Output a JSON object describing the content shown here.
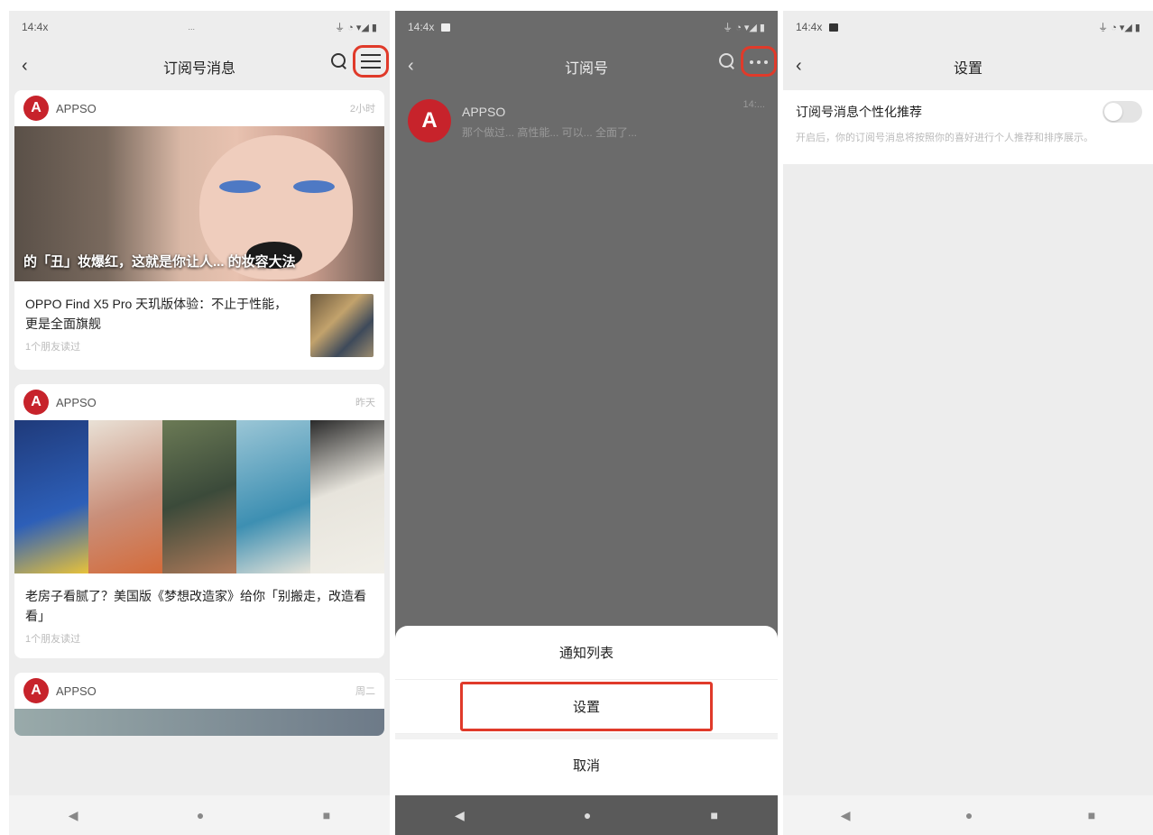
{
  "panel1": {
    "status": {
      "time": "14:4x",
      "center": "...",
      "right": "⏚ ◔ ▾◢ ▮"
    },
    "title": "订阅号消息",
    "cards": [
      {
        "brand": "APPSO",
        "time": "2小时",
        "hero_caption": "的「丑」妆爆红，这就是你让人... 的妆容大法",
        "item_title": "OPPO Find X5 Pro 天玑版体验：不止于性能，更是全面旗舰",
        "item_meta": "1个朋友读过"
      },
      {
        "brand": "APPSO",
        "time": "昨天",
        "item_title": "老房子看腻了？美国版《梦想改造家》给你「别搬走，改造看看」",
        "item_meta": "1个朋友读过"
      },
      {
        "brand": "APPSO",
        "time": "周二"
      }
    ],
    "nav": {
      "back": "◀",
      "home": "●",
      "recent": "■"
    }
  },
  "panel2": {
    "status": {
      "time": "14:4x",
      "right": "⏚ ◔ ▾◢ ▮"
    },
    "title": "订阅号",
    "list": {
      "name": "APPSO",
      "sub": "那个做过... 高性能... 可以... 全面了...",
      "time": "14:..."
    },
    "sheet": {
      "opt1": "通知列表",
      "opt2": "设置",
      "cancel": "取消"
    },
    "nav": {
      "back": "◀",
      "home": "●",
      "recent": "■"
    }
  },
  "panel3": {
    "status": {
      "time": "14:4x",
      "right": "⏚ ◔ ▾◢ ▮"
    },
    "title": "设置",
    "setting": {
      "title": "订阅号消息个性化推荐",
      "desc": "开启后，你的订阅号消息将按照你的喜好进行个人推荐和排序展示。"
    },
    "nav": {
      "back": "◀",
      "home": "●",
      "recent": "■"
    }
  },
  "colors": {
    "accent_red": "#e03a2a",
    "brand_red": "#c7232b"
  }
}
